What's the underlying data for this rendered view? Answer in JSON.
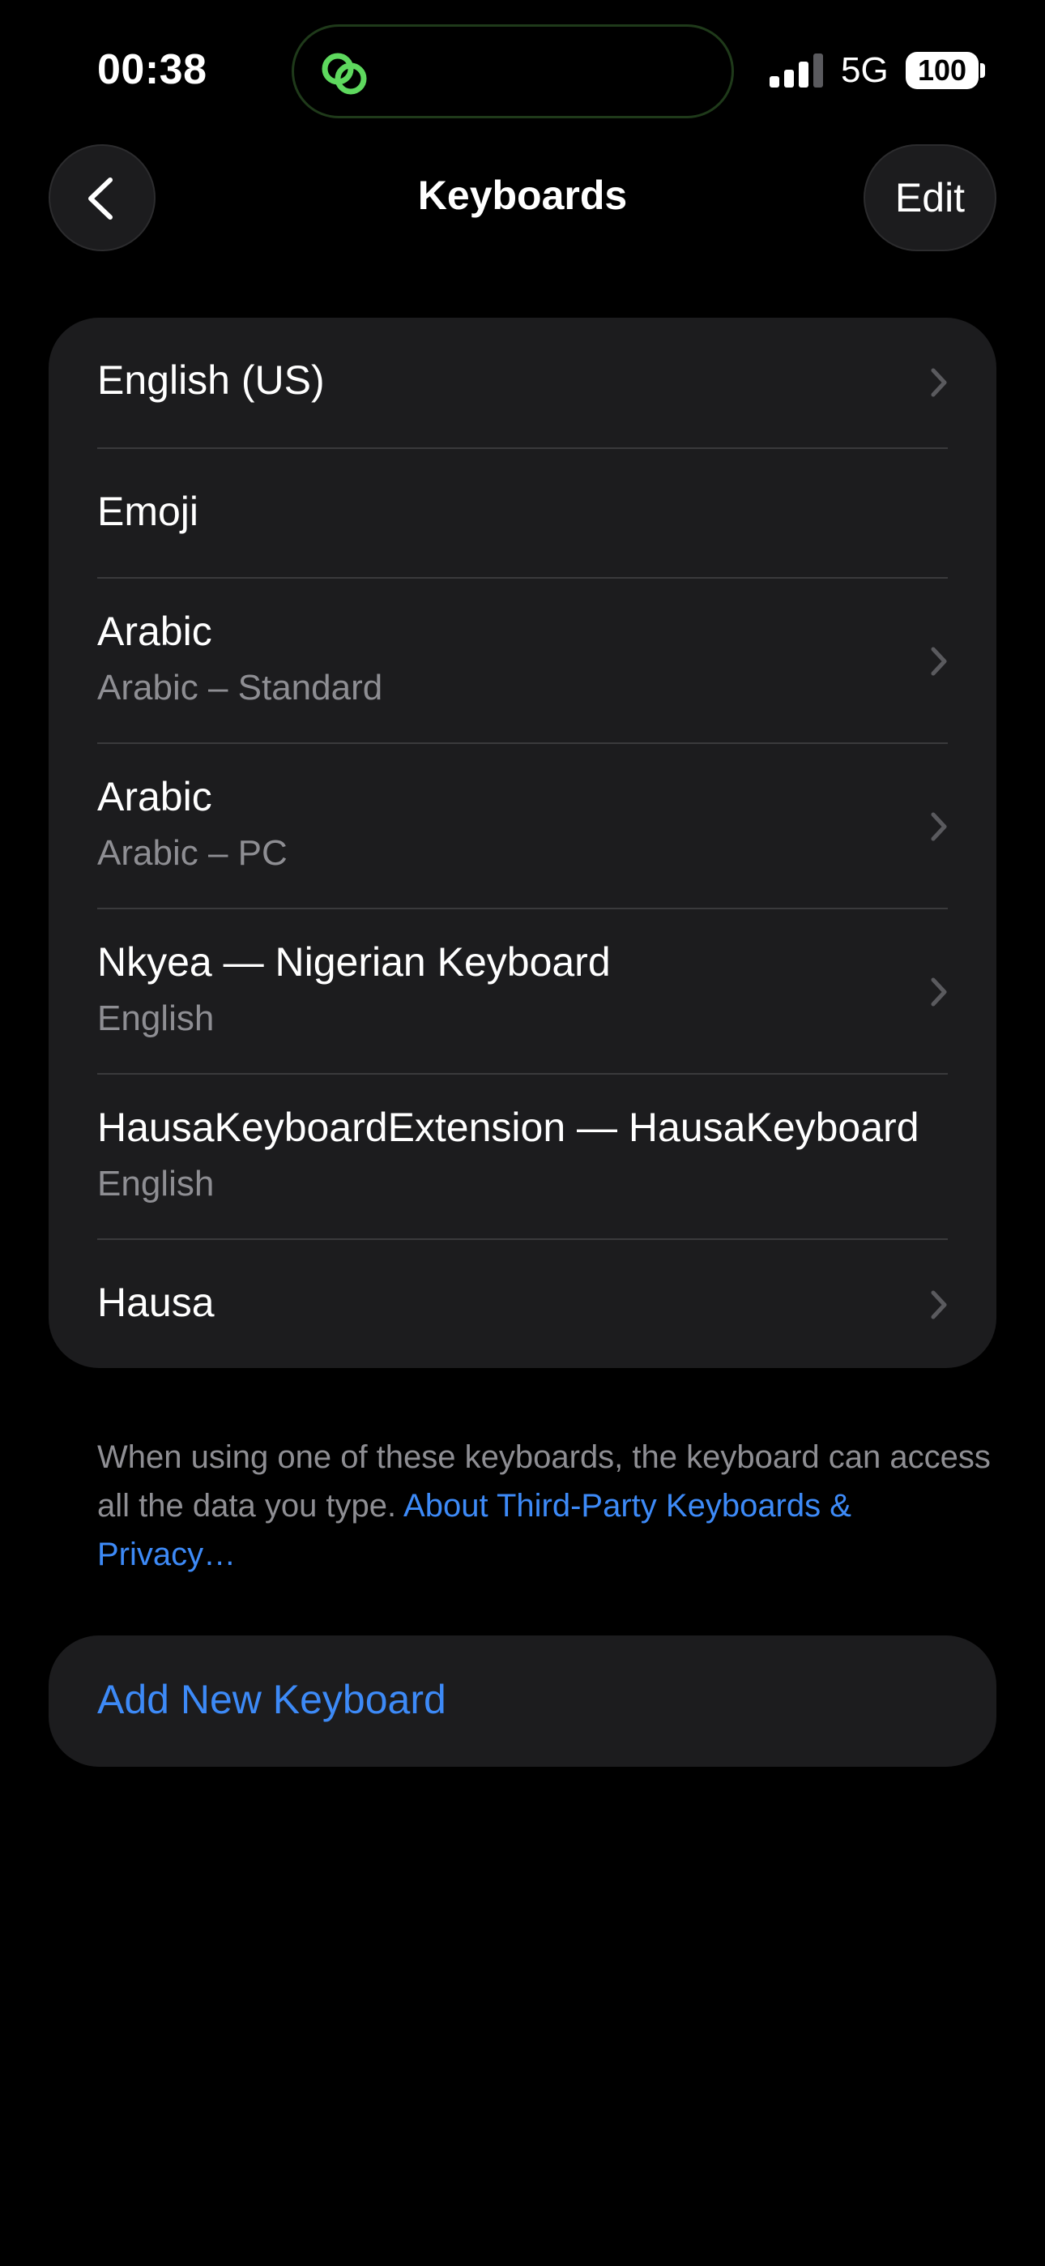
{
  "status_bar": {
    "time": "00:38",
    "network": "5G",
    "battery": "100",
    "island_icon": "link-rings-icon",
    "colors": {
      "island_icon": "#5ed85e"
    }
  },
  "nav": {
    "title": "Keyboards",
    "edit_label": "Edit",
    "back_icon": "chevron-left-icon"
  },
  "keyboards": [
    {
      "title": "English (US)",
      "subtitle": "",
      "chevron": true
    },
    {
      "title": "Emoji",
      "subtitle": "",
      "chevron": false
    },
    {
      "title": "Arabic",
      "subtitle": "Arabic – Standard",
      "chevron": true
    },
    {
      "title": "Arabic",
      "subtitle": "Arabic – PC",
      "chevron": true
    },
    {
      "title": "Nkyea — Nigerian Keyboard",
      "subtitle": "English",
      "chevron": true
    },
    {
      "title": "HausaKeyboardExtension — HausaKeyboard",
      "subtitle": "English",
      "chevron": false
    },
    {
      "title": "Hausa",
      "subtitle": "",
      "chevron": true
    }
  ],
  "footer": {
    "text": "When using one of these keyboards, the keyboard can access all the data you type. ",
    "link": "About Third-Party Keyboards & Privacy…"
  },
  "add_keyboard": {
    "label": "Add New Keyboard"
  },
  "colors": {
    "background": "#000000",
    "card": "#1c1c1e",
    "separator": "#3a3a3c",
    "secondary_text": "#8e8e93",
    "accent": "#3d8af7"
  }
}
